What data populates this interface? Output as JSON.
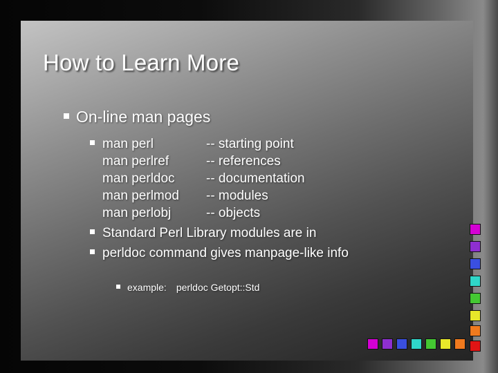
{
  "slide": {
    "title": "How to Learn More",
    "bullet_level1": "On-line man pages",
    "man_rows": [
      {
        "command": "man perl",
        "description": "-- starting point"
      },
      {
        "command": "man perlref",
        "description": "-- references"
      },
      {
        "command": "man perldoc",
        "description": "-- documentation"
      },
      {
        "command": "man perlmod",
        "description": "-- modules"
      },
      {
        "command": "man perlobj",
        "description": "-- objects"
      }
    ],
    "bullets_level2": [
      "Standard Perl Library modules are in",
      "perldoc command gives manpage-like info"
    ],
    "example": {
      "label": "example:",
      "text": "perldoc Getopt::Std"
    }
  },
  "decor": {
    "right_chips": [
      "#d400d4",
      "#8e2fd0",
      "#3a4fe0",
      "#2fd6c9",
      "#44c832",
      "#e8e82a",
      "#f07a1e",
      "#e01414"
    ],
    "bottom_chips": [
      "#d400d4",
      "#8e2fd0",
      "#3a4fe0",
      "#2fd6c9",
      "#44c832",
      "#e8e82a",
      "#f07a1e",
      "#e01414"
    ]
  }
}
